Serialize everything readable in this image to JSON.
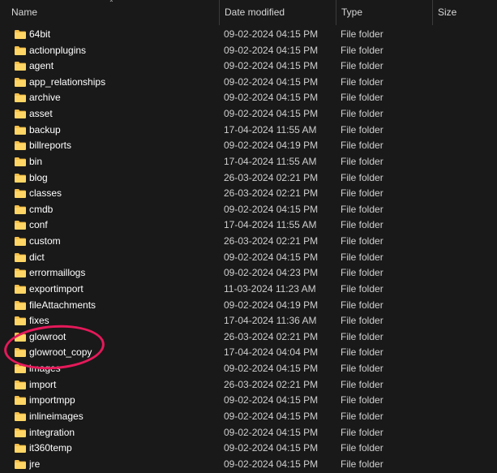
{
  "header": {
    "name": "Name",
    "date_modified": "Date modified",
    "type": "Type",
    "size": "Size"
  },
  "colors": {
    "background": "#191919",
    "folder": "#f5c04a",
    "annotation": "#e5195a"
  },
  "icon": "folder-icon",
  "rows": [
    {
      "name": "64bit",
      "date": "09-02-2024 04:15 PM",
      "type": "File folder"
    },
    {
      "name": "actionplugins",
      "date": "09-02-2024 04:15 PM",
      "type": "File folder"
    },
    {
      "name": "agent",
      "date": "09-02-2024 04:15 PM",
      "type": "File folder"
    },
    {
      "name": "app_relationships",
      "date": "09-02-2024 04:15 PM",
      "type": "File folder"
    },
    {
      "name": "archive",
      "date": "09-02-2024 04:15 PM",
      "type": "File folder"
    },
    {
      "name": "asset",
      "date": "09-02-2024 04:15 PM",
      "type": "File folder"
    },
    {
      "name": "backup",
      "date": "17-04-2024 11:55 AM",
      "type": "File folder"
    },
    {
      "name": "billreports",
      "date": "09-02-2024 04:19 PM",
      "type": "File folder"
    },
    {
      "name": "bin",
      "date": "17-04-2024 11:55 AM",
      "type": "File folder"
    },
    {
      "name": "blog",
      "date": "26-03-2024 02:21 PM",
      "type": "File folder"
    },
    {
      "name": "classes",
      "date": "26-03-2024 02:21 PM",
      "type": "File folder"
    },
    {
      "name": "cmdb",
      "date": "09-02-2024 04:15 PM",
      "type": "File folder"
    },
    {
      "name": "conf",
      "date": "17-04-2024 11:55 AM",
      "type": "File folder"
    },
    {
      "name": "custom",
      "date": "26-03-2024 02:21 PM",
      "type": "File folder"
    },
    {
      "name": "dict",
      "date": "09-02-2024 04:15 PM",
      "type": "File folder"
    },
    {
      "name": "errormaillogs",
      "date": "09-02-2024 04:23 PM",
      "type": "File folder"
    },
    {
      "name": "exportimport",
      "date": "11-03-2024 11:23 AM",
      "type": "File folder"
    },
    {
      "name": "fileAttachments",
      "date": "09-02-2024 04:19 PM",
      "type": "File folder"
    },
    {
      "name": "fixes",
      "date": "17-04-2024 11:36 AM",
      "type": "File folder"
    },
    {
      "name": "glowroot",
      "date": "26-03-2024 02:21 PM",
      "type": "File folder"
    },
    {
      "name": "glowroot_copy",
      "date": "17-04-2024 04:04 PM",
      "type": "File folder"
    },
    {
      "name": "images",
      "date": "09-02-2024 04:15 PM",
      "type": "File folder"
    },
    {
      "name": "import",
      "date": "26-03-2024 02:21 PM",
      "type": "File folder"
    },
    {
      "name": "importmpp",
      "date": "09-02-2024 04:15 PM",
      "type": "File folder"
    },
    {
      "name": "inlineimages",
      "date": "09-02-2024 04:15 PM",
      "type": "File folder"
    },
    {
      "name": "integration",
      "date": "09-02-2024 04:15 PM",
      "type": "File folder"
    },
    {
      "name": "it360temp",
      "date": "09-02-2024 04:15 PM",
      "type": "File folder"
    },
    {
      "name": "jre",
      "date": "09-02-2024 04:15 PM",
      "type": "File folder"
    }
  ]
}
